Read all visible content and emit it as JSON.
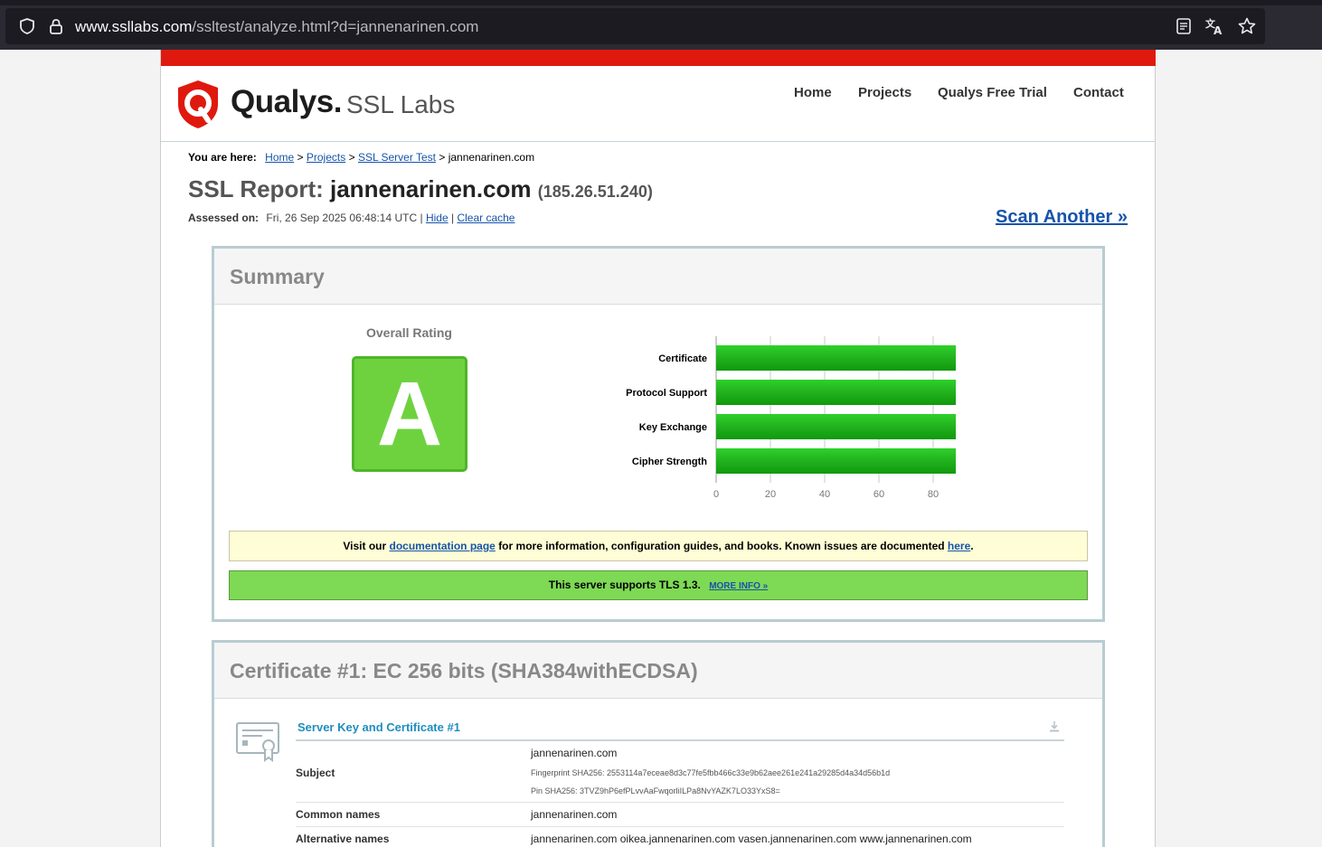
{
  "browser": {
    "url_domain": "www.ssllabs.com",
    "url_path": "/ssltest/analyze.html?d=jannenarinen.com",
    "icons": [
      "shield-icon",
      "lock-icon",
      "reader-view-icon",
      "translate-icon",
      "bookmark-star-icon"
    ]
  },
  "header": {
    "logo_brand": "Qualys.",
    "logo_product": "SSL Labs",
    "nav": [
      "Home",
      "Projects",
      "Qualys Free Trial",
      "Contact"
    ]
  },
  "breadcrumb": {
    "label": "You are here:",
    "items": [
      "Home",
      "Projects",
      "SSL Server Test"
    ],
    "current": "jannenarinen.com",
    "sep": ">"
  },
  "report": {
    "title_prefix": "SSL Report:",
    "host": "jannenarinen.com",
    "ip": "(185.26.51.240)",
    "assessed_label": "Assessed on:",
    "assessed_value": "Fri, 26 Sep 2025 06:48:14 UTC |",
    "hide_link": "Hide",
    "pipe": "|",
    "clear_cache_link": "Clear cache",
    "scan_another": "Scan Another »"
  },
  "summary": {
    "title": "Summary",
    "overall_rating_label": "Overall Rating",
    "grade": "A",
    "doc_note_prefix": "Visit our",
    "doc_link": "documentation page",
    "doc_note_middle": "for more information, configuration guides, and books. Known issues are documented",
    "doc_here_link": "here",
    "doc_note_end": ".",
    "tls_note": "This server supports TLS 1.3.",
    "tls_more": "MORE INFO »"
  },
  "chart_data": {
    "type": "bar",
    "orientation": "horizontal",
    "categories": [
      "Certificate",
      "Protocol Support",
      "Key Exchange",
      "Cipher Strength"
    ],
    "values": [
      100,
      100,
      90,
      90
    ],
    "xlim": [
      0,
      100
    ],
    "xticks": [
      0,
      20,
      40,
      60,
      80,
      100
    ],
    "grid": true,
    "bar_color": "#22b11e"
  },
  "certificate": {
    "title": "Certificate #1: EC 256 bits (SHA384withECDSA)",
    "section_title": "Server Key and Certificate #1",
    "rows": [
      {
        "label": "Subject",
        "value": "jannenarinen.com",
        "fingerprint": "Fingerprint SHA256: 2553114a7eceae8d3c77fe5fbb466c33e9b62aee261e241a29285d4a34d56b1d",
        "pin": "Pin SHA256: 3TVZ9hP6efPLvvAaFwqorliILPa8NvYAZK7LO33YxS8="
      },
      {
        "label": "Common names",
        "value": "jannenarinen.com"
      },
      {
        "label": "Alternative names",
        "value": "jannenarinen.com oikea.jannenarinen.com vasen.jannenarinen.com www.jannenarinen.com"
      }
    ]
  },
  "colors": {
    "red_bar": "#e0190e",
    "grade_green": "#6ed23f",
    "link_blue": "#1654aa",
    "tls_green": "#7ed955",
    "note_yellow": "#fffdd6"
  }
}
